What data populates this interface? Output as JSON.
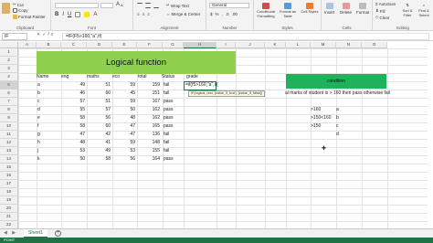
{
  "ribbon": {
    "clipboard": {
      "group": "Clipboard",
      "cut": "Cut",
      "copy": "Copy",
      "format_painter": "Format Painter"
    },
    "font": {
      "group": "Font"
    },
    "alignment": {
      "group": "Alignment",
      "wrap": "Wrap Text",
      "merge": "Merge & Center"
    },
    "number": {
      "group": "Number",
      "format": "General"
    },
    "styles": {
      "group": "Styles",
      "conditional": "Conditional Formatting",
      "format_table": "Format as Table",
      "cell_styles": "Cell Styles"
    },
    "cells": {
      "group": "Cells",
      "insert": "Insert",
      "delete": "Delete",
      "format": "Format"
    },
    "editing": {
      "group": "Editing",
      "autosum": "AutoSum",
      "fill": "Fill",
      "clear": "Clear",
      "sort": "Sort & Filter",
      "find": "Find & Select"
    }
  },
  "formula_bar": {
    "name_box": "IF",
    "formula": "=IF(F5>160,\"a\",if("
  },
  "columns": [
    "A",
    "B",
    "C",
    "D",
    "E",
    "F",
    "G",
    "H",
    "I",
    "J",
    "K",
    "L",
    "M",
    "N",
    "O"
  ],
  "rows": [
    "1",
    "2",
    "3",
    "4",
    "5",
    "6",
    "7",
    "8",
    "9",
    "10",
    "11",
    "12",
    "13",
    "14",
    "15",
    "16",
    "17",
    "18",
    "19",
    "20",
    "21",
    "22"
  ],
  "table": {
    "title": "Logical function",
    "headers": {
      "name": "Name",
      "eng": "eng",
      "maths": "maths",
      "eco": "eco",
      "total": "total",
      "status": "Status",
      "grade": "grade"
    },
    "records": [
      {
        "name": "a",
        "eng": "49",
        "maths": "51",
        "eco": "59",
        "total": "159",
        "status": "fail"
      },
      {
        "name": "b",
        "eng": "46",
        "maths": "60",
        "eco": "45",
        "total": "151",
        "status": "fail"
      },
      {
        "name": "c",
        "eng": "57",
        "maths": "51",
        "eco": "59",
        "total": "167",
        "status": "pass"
      },
      {
        "name": "d",
        "eng": "55",
        "maths": "57",
        "eco": "50",
        "total": "162",
        "status": "pass"
      },
      {
        "name": "e",
        "eng": "58",
        "maths": "56",
        "eco": "48",
        "total": "162",
        "status": "pass"
      },
      {
        "name": "f",
        "eng": "58",
        "maths": "60",
        "eco": "47",
        "total": "165",
        "status": "pass"
      },
      {
        "name": "g",
        "eng": "47",
        "maths": "42",
        "eco": "47",
        "total": "136",
        "status": "fail"
      },
      {
        "name": "h",
        "eng": "48",
        "maths": "41",
        "eco": "59",
        "total": "148",
        "status": "fail"
      },
      {
        "name": "j",
        "eng": "53",
        "maths": "49",
        "eco": "53",
        "total": "155",
        "status": "fail"
      },
      {
        "name": "k",
        "eng": "50",
        "maths": "58",
        "eco": "56",
        "total": "164",
        "status": "pass"
      }
    ],
    "active_cell_text": "=if(f5>160,\"a\",if(",
    "tooltip": "IF(logical_test, [value_if_true], [value_if_false])"
  },
  "condition": {
    "title": "condition",
    "note": "al marks of student is > 160 then pass otherwise fail",
    "rules": [
      {
        "range": ">160",
        "grade": "a"
      },
      {
        "range": ">150<160",
        "grade": "b"
      },
      {
        "range": ">150",
        "grade": "c"
      },
      {
        "range": "",
        "grade": "d"
      }
    ]
  },
  "sheet": {
    "tab": "Sheet1",
    "add": "+",
    "nav": "◀ ▶"
  },
  "status": {
    "mode": "POINT"
  },
  "colors": {
    "excel_green": "#217346",
    "title_fill": "#8fd14f",
    "condition_fill": "#1fb25a"
  }
}
